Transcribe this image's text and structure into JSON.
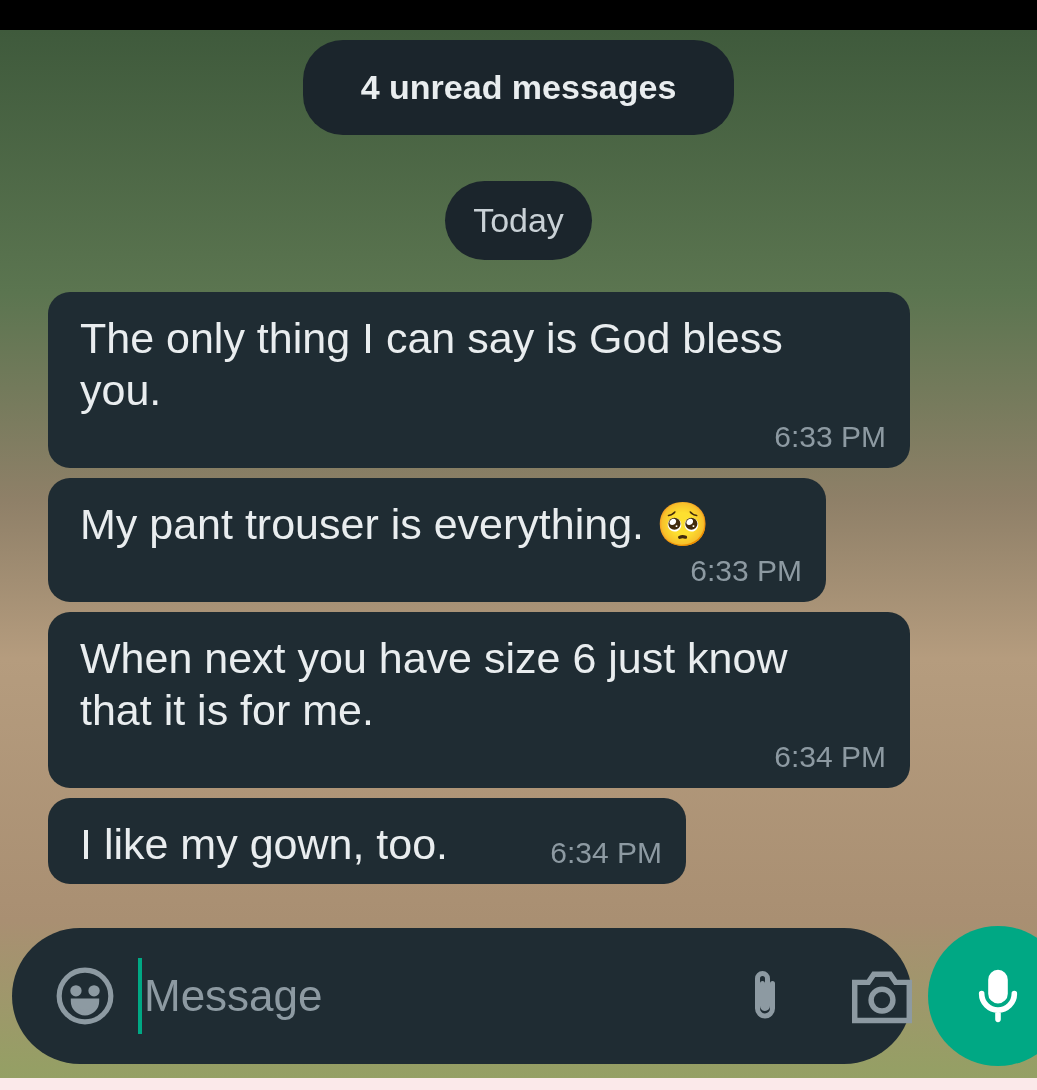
{
  "unread_banner": "4 unread messages",
  "date_chip": "Today",
  "messages": [
    {
      "text": "The only thing I can say is God bless you.",
      "time": "6:33 PM"
    },
    {
      "text": "My pant trouser is everything. 🥺",
      "time": "6:33 PM"
    },
    {
      "text": "When next you have size 6 just know that it is for me.",
      "time": "6:34 PM"
    },
    {
      "text": "I like my gown, too.",
      "time": "6:34 PM"
    }
  ],
  "composer": {
    "placeholder": "Message"
  }
}
